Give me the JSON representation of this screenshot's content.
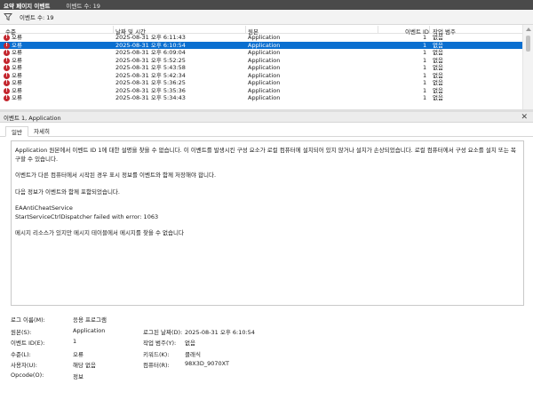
{
  "title": {
    "main": "요약 페이지 이벤트",
    "count": "이벤트 수: 19"
  },
  "filter": {
    "icon": "filter-icon",
    "count": "이벤트 수: 19"
  },
  "grid": {
    "columns": [
      "수준",
      "날짜 및 시간",
      "원본",
      "이벤트 ID",
      "작업 범주"
    ],
    "rows": [
      {
        "level": "오류",
        "datetime": "2025-08-31 오후 6:11:43",
        "source": "Application",
        "id": "1",
        "category": "없음"
      },
      {
        "level": "오류",
        "datetime": "2025-08-31 오후 6:10:54",
        "source": "Application",
        "id": "1",
        "category": "없음"
      },
      {
        "level": "오류",
        "datetime": "2025-08-31 오후 6:09:04",
        "source": "Application",
        "id": "1",
        "category": "없음"
      },
      {
        "level": "오류",
        "datetime": "2025-08-31 오후 5:52:25",
        "source": "Application",
        "id": "1",
        "category": "없음"
      },
      {
        "level": "오류",
        "datetime": "2025-08-31 오후 5:43:58",
        "source": "Application",
        "id": "1",
        "category": "없음"
      },
      {
        "level": "오류",
        "datetime": "2025-08-31 오후 5:42:34",
        "source": "Application",
        "id": "1",
        "category": "없음"
      },
      {
        "level": "오류",
        "datetime": "2025-08-31 오후 5:36:25",
        "source": "Application",
        "id": "1",
        "category": "없음"
      },
      {
        "level": "오류",
        "datetime": "2025-08-31 오후 5:35:36",
        "source": "Application",
        "id": "1",
        "category": "없음"
      },
      {
        "level": "오류",
        "datetime": "2025-08-31 오후 5:34:43",
        "source": "Application",
        "id": "1",
        "category": "없음"
      }
    ],
    "selected_index": 1
  },
  "detail": {
    "header": "이벤트 1, Application",
    "tabs": [
      "일반",
      "자세히"
    ],
    "description": {
      "p1": "Application 원본에서 이벤트 ID 1에 대한 설명을 찾을 수 없습니다. 이 이벤트를 발생시킨 구성 요소가 로컬 컴퓨터에 설치되어 있지 않거나 설치가 손상되었습니다. 로컬 컴퓨터에서 구성 요소를 설치 또는 복구할 수 있습니다.",
      "p2": "이벤트가 다른 컴퓨터에서 시작된 경우 표시 정보를 이벤트와 함께 저장해야 합니다.",
      "p3": "다음 정보가 이벤트와 함께 포함되었습니다.",
      "p4a": "EAAntiCheatService",
      "p4b": "StartServiceCtrlDispatcher failed with error: 1063",
      "p5": "메시지 리소스가 있지만 메시지 테이블에서 메시지를 찾을 수 없습니다"
    },
    "properties": {
      "log_name_label": "로그 이름(M):",
      "log_name_value": "응용 프로그램",
      "source_label": "원본(S):",
      "source_value": "Application",
      "logged_label": "로그된 날짜(D):",
      "logged_value": "2025-08-31 오후 6:10:54",
      "event_id_label": "이벤트 ID(E):",
      "event_id_value": "1",
      "task_label": "작업 범주(Y):",
      "task_value": "없음",
      "level_label": "수준(L):",
      "level_value": "오류",
      "keywords_label": "키워드(K):",
      "keywords_value": "클래식",
      "user_label": "사용자(U):",
      "user_value": "해당 없음",
      "computer_label": "컴퓨터(R):",
      "computer_value": "98X3D_9070XT",
      "opcode_label": "Opcode(O):",
      "opcode_value": "정보"
    }
  },
  "colors": {
    "selection": "#0a6fd0",
    "error": "#c4262e",
    "titlebar": "#4a4a4a"
  }
}
